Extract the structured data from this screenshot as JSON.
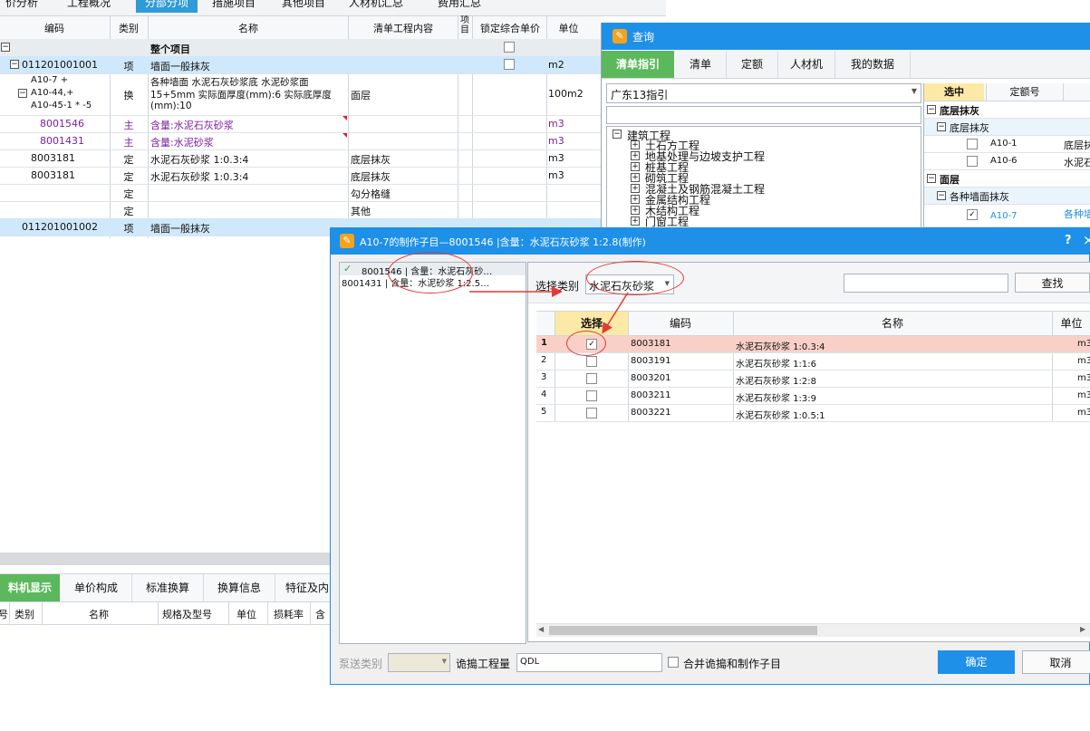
{
  "top_tabs": [
    "价分析",
    "工程概况",
    "分部分项",
    "措施项目",
    "其他项目",
    "人材机汇总",
    "费用汇总"
  ],
  "main_table": {
    "headers": {
      "code": "编码",
      "type": "类别",
      "name": "名称",
      "content": "清单工程内容",
      "item": "项目",
      "lock": "锁定综合单价",
      "unit": "单位"
    },
    "rows": [
      {
        "code": "",
        "type": "",
        "name": "整个项目",
        "content": "",
        "unit": ""
      },
      {
        "code": "011201001001",
        "type": "项",
        "name": "墙面一般抹灰",
        "content": "",
        "unit": "m2"
      },
      {
        "code_lines": [
          "A10-7 +",
          "A10-44,+",
          "A10-45-1 * -5"
        ],
        "type": "换",
        "name_lines": [
          "各种墙面 水泥石灰砂浆底 水泥砂浆面",
          "15+5mm 实际面厚度(mm):6 实际底厚度",
          "(mm):10"
        ],
        "content": "面层",
        "unit": "100m2"
      },
      {
        "code": "8001546",
        "type": "主",
        "name": "含量:水泥石灰砂浆",
        "content": "",
        "unit": "m3"
      },
      {
        "code": "8001431",
        "type": "主",
        "name": "含量:水泥砂浆",
        "content": "",
        "unit": "m3"
      },
      {
        "code": "8003181",
        "type": "定",
        "name": "水泥石灰砂浆 1:0.3:4",
        "content": "底层抹灰",
        "unit": "m3"
      },
      {
        "code": "8003181",
        "type": "定",
        "name": "水泥石灰砂浆 1:0.3:4",
        "content": "底层抹灰",
        "unit": "m3"
      },
      {
        "code": "",
        "type": "定",
        "name": "",
        "content": "勾分格缝",
        "unit": ""
      },
      {
        "code": "",
        "type": "定",
        "name": "",
        "content": "其他",
        "unit": ""
      },
      {
        "code": "011201001002",
        "type": "项",
        "name": "墙面一般抹灰",
        "content": "",
        "unit": ""
      }
    ]
  },
  "bottom_tabs": [
    "料机显示",
    "单价构成",
    "标准换算",
    "换算信息",
    "特征及内"
  ],
  "bottom_headers": [
    "号",
    "类别",
    "名称",
    "规格及型号",
    "单位",
    "损耗率",
    "含"
  ],
  "query_panel": {
    "title": "查询",
    "tabs": [
      "清单指引",
      "清单",
      "定额",
      "人材机",
      "我的数据"
    ],
    "dropdown": "广东13指引",
    "tree_root": "建筑工程",
    "tree_items": [
      "土石方工程",
      "地基处理与边坡支护工程",
      "桩基工程",
      "砌筑工程",
      "混凝土及钢筋混凝土工程",
      "金属结构工程",
      "木结构工程",
      "门窗工程"
    ],
    "right_headers": [
      "选中",
      "定额号"
    ],
    "right_rows": [
      {
        "kind": "group",
        "label": "底层抹灰"
      },
      {
        "kind": "sub",
        "label": "底层抹灰"
      },
      {
        "kind": "item",
        "code": "A10-1",
        "desc": "底层抹"
      },
      {
        "kind": "item",
        "code": "A10-6",
        "desc": "水泥石"
      },
      {
        "kind": "group",
        "label": "面层"
      },
      {
        "kind": "sub",
        "label": "各种墙面抹灰"
      },
      {
        "kind": "item",
        "code": "A10-7",
        "desc": "各种墙"
      }
    ]
  },
  "dialog": {
    "title": "A10-7的制作子目—8001546 |含量：水泥石灰砂浆 1:2.8(制作)",
    "help": "?",
    "close": "×",
    "left_items": [
      "8001546 | 含量：水泥石灰砂…",
      "8001431 | 含量：水泥砂浆 1:2.5…"
    ],
    "select_label": "选择类别",
    "select_value": "水泥石灰砂浆",
    "find_button": "查找",
    "grid_headers": {
      "select": "选择",
      "code": "编码",
      "name": "名称",
      "unit": "单位"
    },
    "grid_rows": [
      {
        "no": "1",
        "checked": true,
        "code": "8003181",
        "name": "水泥石灰砂浆 1:0.3:4",
        "unit": "m3"
      },
      {
        "no": "2",
        "checked": false,
        "code": "8003191",
        "name": "水泥石灰砂浆 1:1:6",
        "unit": "m3"
      },
      {
        "no": "3",
        "checked": false,
        "code": "8003201",
        "name": "水泥石灰砂浆 1:2:8",
        "unit": "m3"
      },
      {
        "no": "4",
        "checked": false,
        "code": "8003211",
        "name": "水泥石灰砂浆 1:3:9",
        "unit": "m3"
      },
      {
        "no": "5",
        "checked": false,
        "code": "8003221",
        "name": "水泥石灰砂浆 1:0.5:1",
        "unit": "m3"
      }
    ],
    "pump_label": "泵送类别",
    "demolish_label": "诡搗工程量",
    "demolish_value": "QDL",
    "merge_label": "合并诡搗和制作子目",
    "ok": "确定",
    "cancel": "取消"
  },
  "colors": {
    "accent_green": "#5cb85c",
    "title_blue": "#1e90e8",
    "highlight_row": "#f9d0c8",
    "selected_row": "#cfe8fb",
    "annotation": "#e53935"
  }
}
